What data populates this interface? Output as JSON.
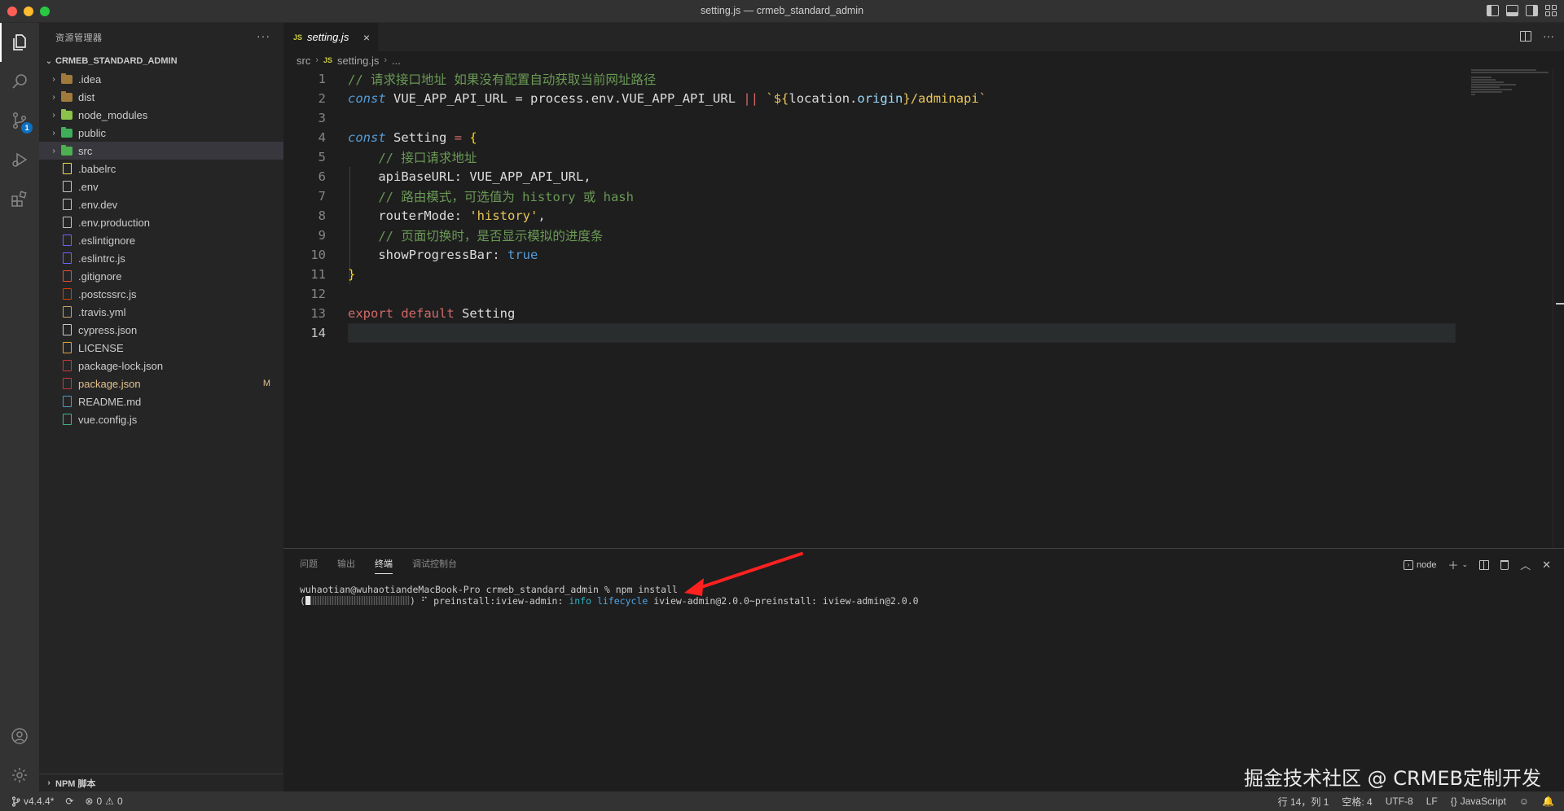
{
  "window": {
    "title": "setting.js — crmeb_standard_admin"
  },
  "activity": {
    "scm_badge": "1"
  },
  "sidebar": {
    "title": "资源管理器",
    "more": "···",
    "project": "CRMEB_STANDARD_ADMIN",
    "items": [
      {
        "name": ".idea",
        "type": "folder",
        "icon_color": "#a07a3a",
        "status": ""
      },
      {
        "name": "dist",
        "type": "folder",
        "icon_color": "#a07a3a",
        "status": ""
      },
      {
        "name": "node_modules",
        "type": "folder",
        "icon_color": "#8bc34a",
        "status": ""
      },
      {
        "name": "public",
        "type": "folder",
        "icon_color": "#3fae5a",
        "status": ""
      },
      {
        "name": "src",
        "type": "folder",
        "icon_color": "#4caf50",
        "status": ""
      },
      {
        "name": ".babelrc",
        "type": "file",
        "icon_color": "#f5da55",
        "status": ""
      },
      {
        "name": ".env",
        "type": "file",
        "icon_color": "#c5c5c5",
        "status": ""
      },
      {
        "name": ".env.dev",
        "type": "file",
        "icon_color": "#c5c5c5",
        "status": ""
      },
      {
        "name": ".env.production",
        "type": "file",
        "icon_color": "#c5c5c5",
        "status": ""
      },
      {
        "name": ".eslintignore",
        "type": "file",
        "icon_color": "#6c63ff",
        "status": ""
      },
      {
        "name": ".eslintrc.js",
        "type": "file",
        "icon_color": "#6c63ff",
        "status": ""
      },
      {
        "name": ".gitignore",
        "type": "file",
        "icon_color": "#e84e31",
        "status": ""
      },
      {
        "name": ".postcssrc.js",
        "type": "file",
        "icon_color": "#dd3a0a",
        "status": ""
      },
      {
        "name": ".travis.yml",
        "type": "file",
        "icon_color": "#c5a572",
        "status": ""
      },
      {
        "name": "cypress.json",
        "type": "file",
        "icon_color": "#cccccc",
        "status": ""
      },
      {
        "name": "LICENSE",
        "type": "file",
        "icon_color": "#e2a33a",
        "status": ""
      },
      {
        "name": "package-lock.json",
        "type": "file",
        "icon_color": "#cb3837",
        "status": ""
      },
      {
        "name": "package.json",
        "type": "file",
        "icon_color": "#cb3837",
        "status": "M"
      },
      {
        "name": "README.md",
        "type": "file",
        "icon_color": "#519aba",
        "status": ""
      },
      {
        "name": "vue.config.js",
        "type": "file",
        "icon_color": "#41b883",
        "status": ""
      }
    ],
    "npm_section": "NPM 脚本"
  },
  "editor": {
    "tab_badge": "JS",
    "tab_label": "setting.js",
    "tab_close": "×",
    "more": "···",
    "breadcrumb": {
      "folder": "src",
      "file_badge": "JS",
      "file": "setting.js",
      "tail": "..."
    },
    "line_numbers": [
      "1",
      "2",
      "3",
      "4",
      "5",
      "6",
      "7",
      "8",
      "9",
      "10",
      "11",
      "12",
      "13",
      "14"
    ],
    "code": {
      "l1_comment": "// 请求接口地址 如果没有配置自动获取当前网址路径",
      "l2_const": "const",
      "l2_name": "VUE_APP_API_URL",
      "l2_eq": "=",
      "l2_process": "process",
      "l2_env": "env",
      "l2_var": "VUE_APP_API_URL",
      "l2_or": "||",
      "l2_tpl_open": "`${",
      "l2_location": "location",
      "l2_origin": "origin",
      "l2_tpl_close": "}/adminapi`",
      "l4_const": "const",
      "l4_name": "Setting",
      "l4_eq": "=",
      "l4_brace": "{",
      "l5_comment": "// 接口请求地址",
      "l6_key": "apiBaseURL",
      "l6_val": "VUE_APP_API_URL,",
      "l7_comment": "// 路由模式，可选值为 history 或 hash",
      "l8_key": "routerMode",
      "l8_val": "'history'",
      "l9_comment": "// 页面切换时，是否显示模拟的进度条",
      "l10_key": "showProgressBar",
      "l10_val": "true",
      "l11_brace": "}",
      "l13_export": "export",
      "l13_default": "default",
      "l13_name": "Setting"
    }
  },
  "panel": {
    "tabs": [
      "问题",
      "输出",
      "终端",
      "调试控制台"
    ],
    "active_tab": "终端",
    "terminal_name": "node",
    "terminal": {
      "prompt": "wuhaotian@wuhaotiandeMacBook-Pro crmeb_standard_admin % npm install",
      "progress_open": "(",
      "progress_close": ") ⠋ preinstall:iview-admin: ",
      "progress_fraction": 0.05,
      "info": "info",
      "lifecycle": "lifecycle",
      "rest": " iview-admin@2.0.0~preinstall: iview-admin@2.0.0"
    }
  },
  "watermark": "掘金技术社区 @ CRMEB定制开发",
  "statusbar": {
    "branch": "v4.4.4*",
    "errors": "0",
    "warnings": "0",
    "position": "行 14，列 1",
    "spaces": "空格: 4",
    "encoding": "UTF-8",
    "eol": "LF",
    "language": "JavaScript"
  }
}
